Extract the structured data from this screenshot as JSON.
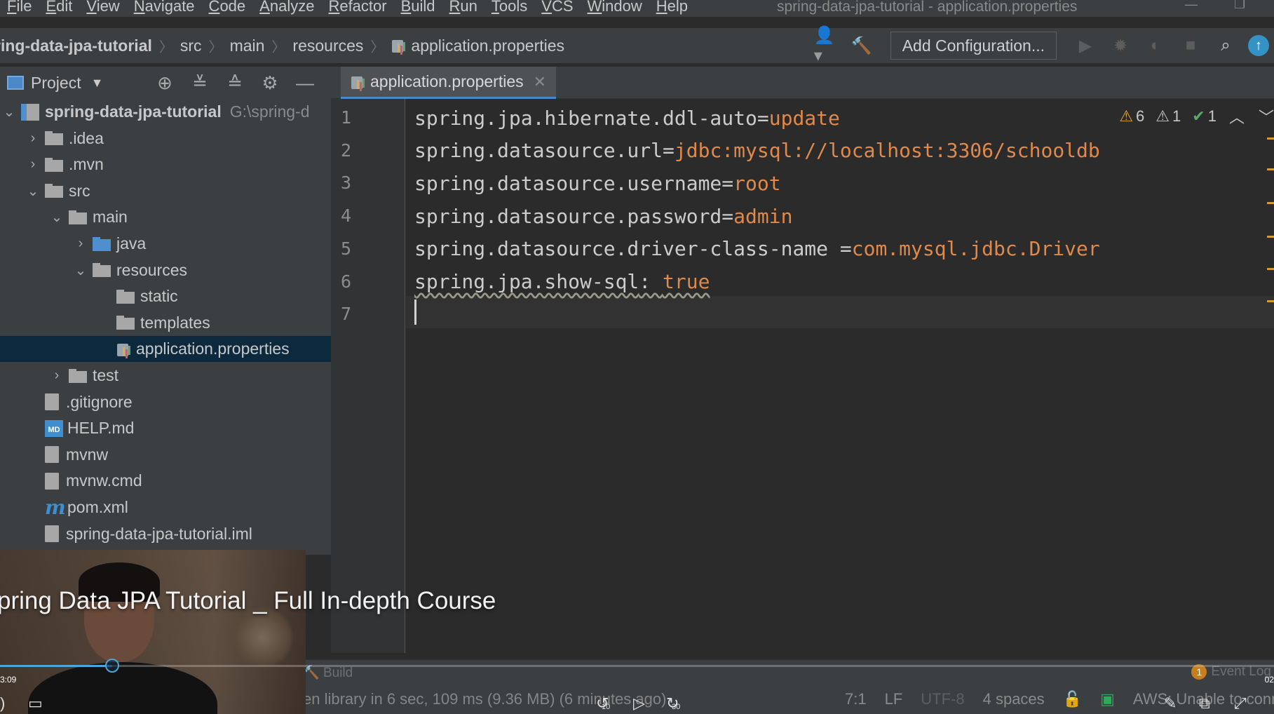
{
  "menu": {
    "items": [
      "File",
      "Edit",
      "View",
      "Navigate",
      "Code",
      "Analyze",
      "Refactor",
      "Build",
      "Run",
      "Tools",
      "VCS",
      "Window",
      "Help"
    ],
    "window_title": "spring-data-jpa-tutorial - application.properties"
  },
  "breadcrumb": {
    "root": "ring-data-jpa-tutorial",
    "parts": [
      "src",
      "main",
      "resources",
      "application.properties"
    ]
  },
  "toolbar": {
    "add_configuration": "Add Configuration..."
  },
  "project_panel": {
    "title": "Project"
  },
  "tree": [
    {
      "label": "spring-data-jpa-tutorial",
      "extra": "G:\\spring-d",
      "depth": 0,
      "arrow": "down",
      "icon": "project-icon",
      "bold": true
    },
    {
      "label": ".idea",
      "depth": 1,
      "arrow": "right",
      "icon": "folder-icon"
    },
    {
      "label": ".mvn",
      "depth": 1,
      "arrow": "right",
      "icon": "folder-icon"
    },
    {
      "label": "src",
      "depth": 1,
      "arrow": "down",
      "icon": "folder-icon"
    },
    {
      "label": "main",
      "depth": 2,
      "arrow": "down",
      "icon": "folder-icon"
    },
    {
      "label": "java",
      "depth": 3,
      "arrow": "right",
      "icon": "blue-folder-icon"
    },
    {
      "label": "resources",
      "depth": 3,
      "arrow": "down",
      "icon": "resources-folder-icon"
    },
    {
      "label": "static",
      "depth": 4,
      "arrow": "",
      "icon": "folder-icon"
    },
    {
      "label": "templates",
      "depth": 4,
      "arrow": "",
      "icon": "folder-icon"
    },
    {
      "label": "application.properties",
      "depth": 4,
      "arrow": "",
      "icon": "properties-file-icon",
      "selected": true
    },
    {
      "label": "test",
      "depth": 2,
      "arrow": "right",
      "icon": "folder-icon"
    },
    {
      "label": ".gitignore",
      "depth": 1,
      "arrow": "",
      "icon": "gitignore-file-icon"
    },
    {
      "label": "HELP.md",
      "depth": 1,
      "arrow": "",
      "icon": "markdown-file-icon"
    },
    {
      "label": "mvnw",
      "depth": 1,
      "arrow": "",
      "icon": "shell-file-icon"
    },
    {
      "label": "mvnw.cmd",
      "depth": 1,
      "arrow": "",
      "icon": "text-file-icon"
    },
    {
      "label": "pom.xml",
      "depth": 1,
      "arrow": "",
      "icon": "maven-file-icon"
    },
    {
      "label": "spring-data-jpa-tutorial.iml",
      "depth": 1,
      "arrow": "",
      "icon": "iml-file-icon"
    }
  ],
  "editor": {
    "tab_label": "application.properties",
    "lines": [
      {
        "num": "1",
        "key": "spring.jpa.hibernate.ddl-auto",
        "sep": "=",
        "value": "update"
      },
      {
        "num": "2",
        "key": "spring.datasource.url",
        "sep": "=",
        "value": "jdbc:mysql://localhost:3306/schooldb"
      },
      {
        "num": "3",
        "key": "spring.datasource.username",
        "sep": "=",
        "value": "root"
      },
      {
        "num": "4",
        "key": "spring.datasource.password",
        "sep": "=",
        "value": "admin"
      },
      {
        "num": "5",
        "key": "spring.datasource.driver-class-name ",
        "sep": "=",
        "value": "com.mysql.jdbc.Driver"
      },
      {
        "num": "6",
        "key": "spring.jpa.show-sql",
        "sep": ": ",
        "value": "true"
      },
      {
        "num": "7",
        "key": "",
        "sep": "",
        "value": ""
      }
    ],
    "inspections": {
      "warnings": "6",
      "weak_warnings": "1",
      "typos": "1"
    }
  },
  "bottom": {
    "build_label": "Build",
    "event_log": "Event Log",
    "event_count": "1",
    "status_message": "en library in 6 sec, 109 ms (9.36 MB) (6 minutes ago)",
    "caret_pos": "7:1",
    "line_sep": "LF",
    "encoding": "UTF-8",
    "indent": "4 spaces",
    "aws": "AWS: Unable to conn"
  },
  "video": {
    "title": "pring Data JPA Tutorial _ Full In-depth Course",
    "time_elapsed": "3:09",
    "time_total": "02",
    "progress": 0.088,
    "skip_back": "10",
    "skip_forward": "30"
  },
  "colors": {
    "accent": "#4a88c7",
    "property_value": "#e1894a",
    "warning": "#e0a530",
    "progress": "#49a7d8"
  }
}
